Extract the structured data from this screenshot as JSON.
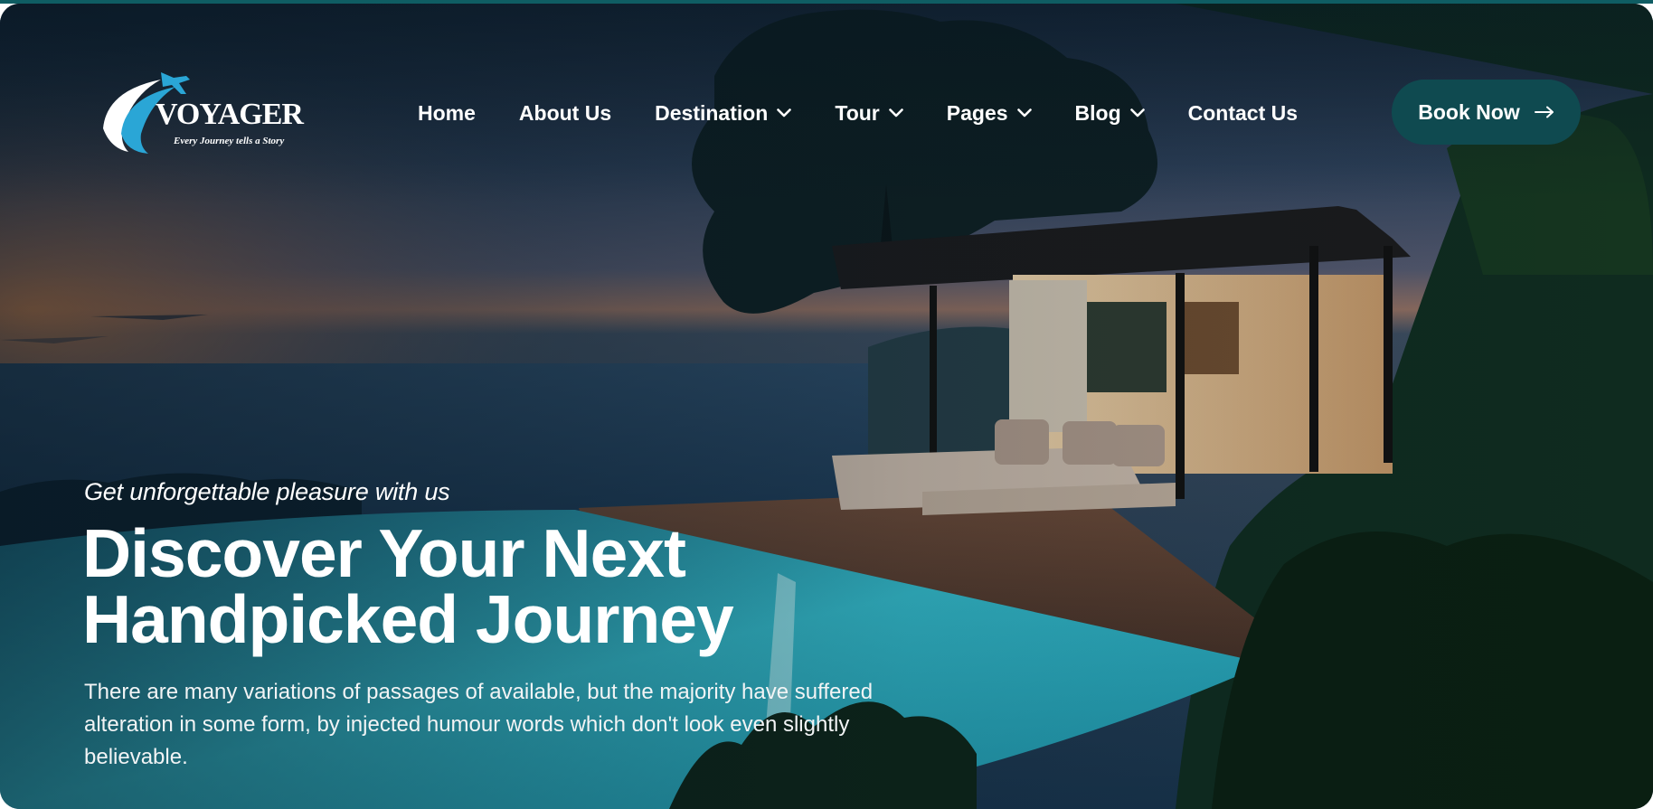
{
  "logo": {
    "wordmark": "VOYAGER",
    "tagline": "Every Journey tells a Story",
    "icon": "airplane-swoosh-icon"
  },
  "nav": {
    "items": [
      {
        "label": "Home",
        "has_dropdown": false
      },
      {
        "label": "About Us",
        "has_dropdown": false
      },
      {
        "label": "Destination",
        "has_dropdown": true
      },
      {
        "label": "Tour",
        "has_dropdown": true
      },
      {
        "label": "Pages",
        "has_dropdown": true
      },
      {
        "label": "Blog",
        "has_dropdown": true
      },
      {
        "label": "Contact Us",
        "has_dropdown": false
      }
    ],
    "dropdown_icon": "chevron-down-icon"
  },
  "cta": {
    "label": "Book Now",
    "icon": "arrow-right-icon"
  },
  "hero": {
    "tagline": "Get unforgettable pleasure with us",
    "headline_line1": "Discover Your Next",
    "headline_line2": "Handpicked Journey",
    "description": "There are many variations of passages of available, but the majority have suffered alteration in some form, by injected humour words which don't look even slightly believable.",
    "background": "infinity-pool-villa-at-dusk-image"
  },
  "colors": {
    "accent": "#0f4a50",
    "top_border": "#0f5d63",
    "logo_blue": "#2aa6d6",
    "text": "#ffffff"
  }
}
